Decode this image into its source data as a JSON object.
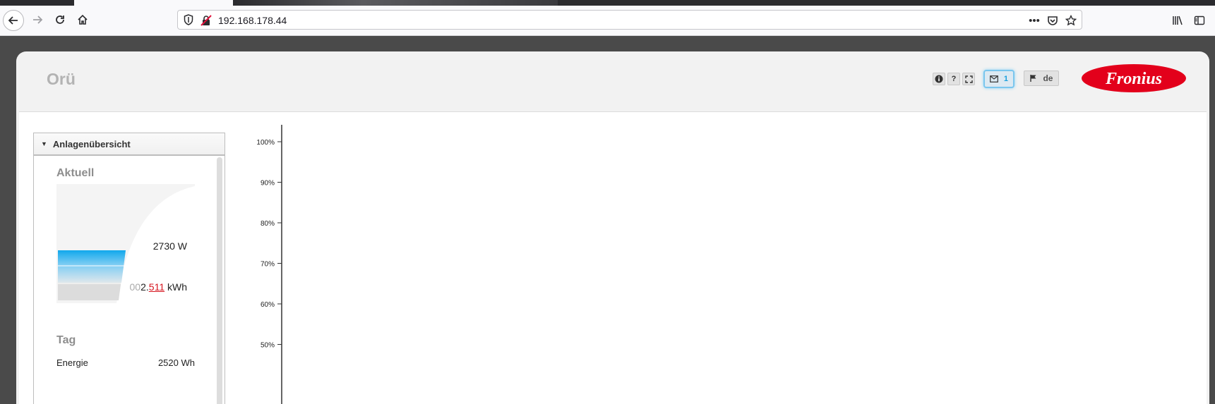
{
  "browser": {
    "url": "192.168.178.44"
  },
  "app": {
    "title": "Orü",
    "message_count": "1",
    "language": "de",
    "tool_buttons": [
      "info-icon",
      "help-icon",
      "fullscreen-icon"
    ],
    "logo_text": "Fronius",
    "brand_color": "#e3001b",
    "accent_color": "#1aa0de"
  },
  "side_panel": {
    "header": "Anlagenübersicht",
    "current": {
      "title": "Aktuell",
      "power": "2730 W",
      "energy_lead": "2.",
      "energy_digits": "511",
      "energy_unit": "kWh",
      "fill_level": 0.35
    },
    "day": {
      "title": "Tag",
      "energy_label": "Energie",
      "energy_value": "2520 Wh"
    }
  },
  "chart_data": {
    "type": "line",
    "title": "",
    "xlabel": "",
    "ylabel": "",
    "ytick_labels": [
      "100%",
      "90%",
      "80%",
      "70%",
      "60%",
      "50%"
    ],
    "yticks": [
      100,
      90,
      80,
      70,
      60,
      50
    ],
    "ylim": [
      50,
      100
    ],
    "series": []
  }
}
